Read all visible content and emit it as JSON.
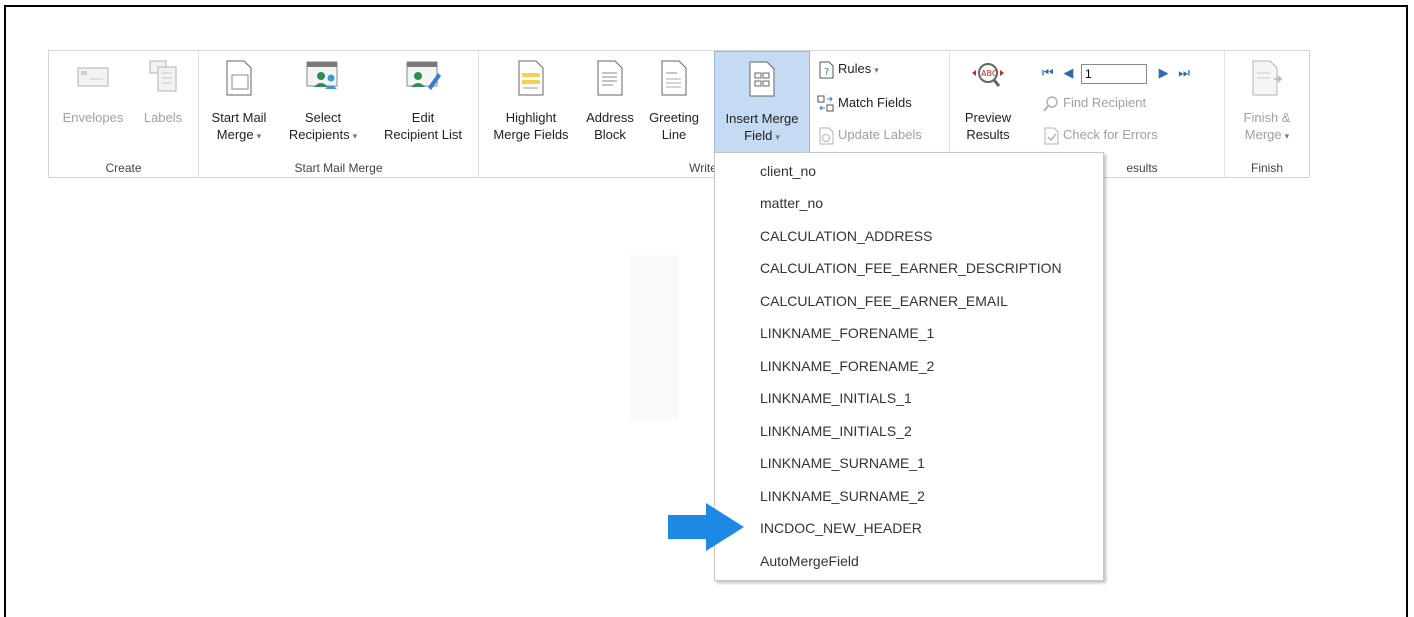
{
  "ribbon": {
    "groups": {
      "create": "Create",
      "start_mail_merge": "Start Mail Merge",
      "write_insert": "Write & Ir",
      "preview_results": "esults",
      "finish": "Finish"
    },
    "buttons": {
      "envelopes": "Envelopes",
      "labels": "Labels",
      "start_mail_merge_1": "Start Mail",
      "start_mail_merge_2": "Merge",
      "select_recipients_1": "Select",
      "select_recipients_2": "Recipients",
      "edit_recipient_list_1": "Edit",
      "edit_recipient_list_2": "Recipient List",
      "highlight_1": "Highlight",
      "highlight_2": "Merge Fields",
      "address_1": "Address",
      "address_2": "Block",
      "greeting_1": "Greeting",
      "greeting_2": "Line",
      "insert_merge_field_1": "Insert Merge",
      "insert_merge_field_2": "Field",
      "preview_1": "Preview",
      "preview_2": "Results",
      "finish_1": "Finish &",
      "finish_2": "Merge"
    },
    "small": {
      "rules": "Rules",
      "match_fields": "Match Fields",
      "update_labels": "Update Labels",
      "find_recipient": "Find Recipient",
      "check_errors": "Check for Errors"
    },
    "record_value": "1",
    "caret": "▾"
  },
  "menu": {
    "items": [
      "client_no",
      "matter_no",
      "CALCULATION_ADDRESS",
      "CALCULATION_FEE_EARNER_DESCRIPTION",
      "CALCULATION_FEE_EARNER_EMAIL",
      "LINKNAME_FORENAME_1",
      "LINKNAME_FORENAME_2",
      "LINKNAME_INITIALS_1",
      "LINKNAME_INITIALS_2",
      "LINKNAME_SURNAME_1",
      "LINKNAME_SURNAME_2",
      "INCDOC_NEW_HEADER",
      "AutoMergeField"
    ]
  },
  "colors": {
    "accent": "#1e88e5",
    "active_bg": "#c5daf3",
    "disabled": "#a0a0a0"
  }
}
